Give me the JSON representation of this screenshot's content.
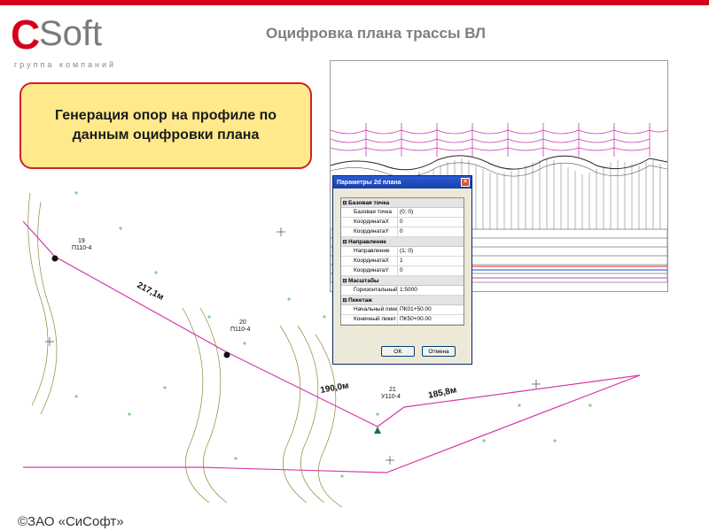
{
  "brand": {
    "logo_c": "C",
    "logo_rest": "Soft",
    "tagline": "группа компаний"
  },
  "title": "Оцифровка плана трассы ВЛ",
  "callout": "Генерация опор на профиле по данным оцифровки плана",
  "plan": {
    "labels": {
      "pole_19": "19",
      "pole_19_code": "П110-4",
      "pole_20": "20",
      "pole_20_code": "П110-4",
      "pole_21": "21",
      "pole_21_code": "У110-4",
      "span_1": "217,1м",
      "span_2": "190,0м",
      "span_3": "185,8м"
    }
  },
  "dialog": {
    "title": "Параметры 2d плана",
    "groups": [
      {
        "name": "Базовая точка",
        "rows": [
          {
            "key": "Базовая точка",
            "value": "(0; 0)"
          },
          {
            "key": "КоординатаX",
            "value": "0"
          },
          {
            "key": "КоординатаY",
            "value": "0"
          }
        ]
      },
      {
        "name": "Направление",
        "rows": [
          {
            "key": "Направление",
            "value": "(1; 0)"
          },
          {
            "key": "КоординатаX",
            "value": "1"
          },
          {
            "key": "КоординатаY",
            "value": "0"
          }
        ]
      },
      {
        "name": "Масштабы",
        "rows": [
          {
            "key": "Горизонтальный",
            "value": "1:5000"
          }
        ]
      },
      {
        "name": "Пикетаж",
        "rows": [
          {
            "key": "Начальный пикет",
            "value": "ПК01+50.00"
          },
          {
            "key": "Конечный пикет",
            "value": "ПК50+00.00"
          }
        ]
      }
    ],
    "ok_label": "OK",
    "cancel_label": "Отмена"
  },
  "footer": "©ЗАО «СиСофт»",
  "colors": {
    "accent": "#d6001c",
    "callout_bg": "#ffe98a",
    "route": "#d63aa8",
    "dialog_title": "#1941a5"
  }
}
